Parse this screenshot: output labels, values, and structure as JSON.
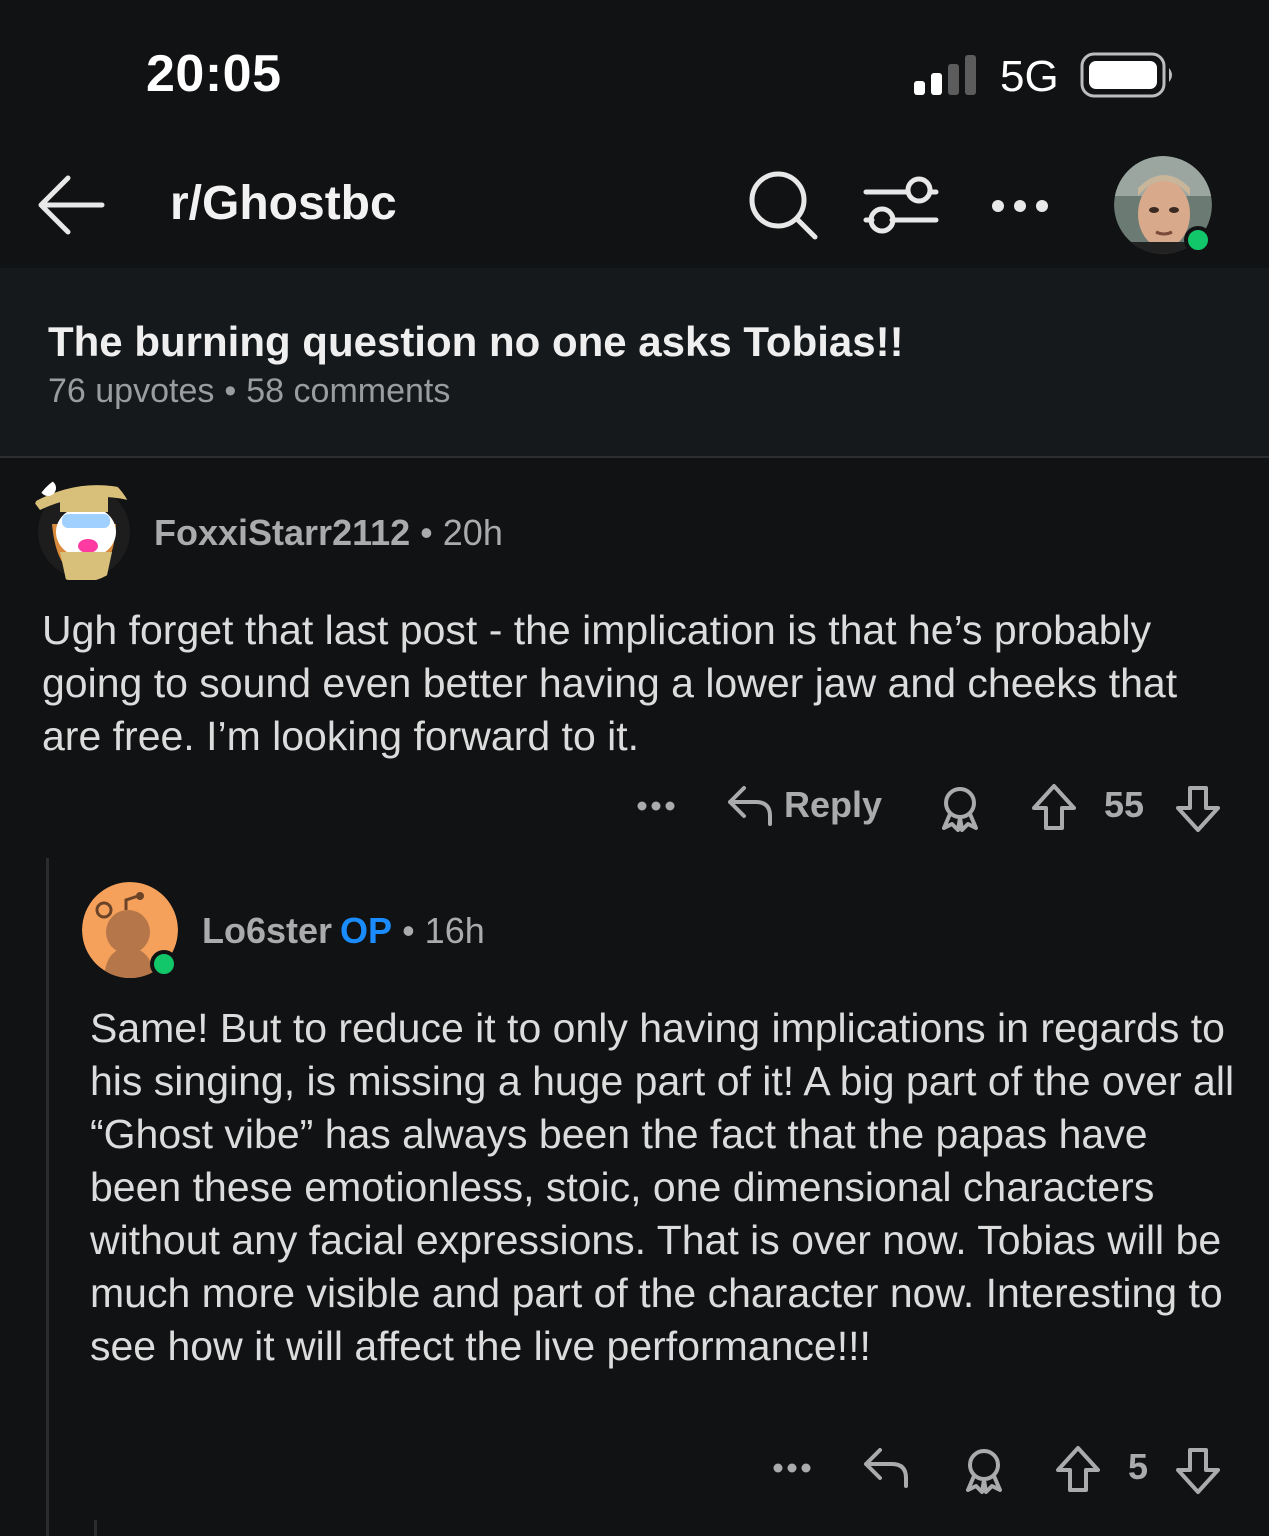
{
  "status_bar": {
    "time": "20:05",
    "network": "5G",
    "icons": [
      "signal-icon",
      "battery-icon"
    ]
  },
  "header": {
    "subreddit": "r/Ghostbc",
    "icons": [
      "back-arrow-icon",
      "search-icon",
      "filter-icon",
      "more-icon",
      "user-avatar"
    ]
  },
  "post": {
    "title": "The burning question no one asks Tobias!!",
    "upvotes": "76 upvotes",
    "separator": "•",
    "comments": "58 comments"
  },
  "comments": [
    {
      "username": "FoxxiStarr2112",
      "separator": "•",
      "age": "20h",
      "body": "Ugh forget that last post - the implication is that he’s probably going to sound even better having a lower jaw and cheeks that are free. I’m looking forward to it.",
      "reply_label": "Reply",
      "score": "55",
      "icons": [
        "more-icon",
        "reply-icon",
        "award-icon",
        "upvote-icon",
        "downvote-icon"
      ]
    },
    {
      "username": "Lo6ster",
      "op_badge": "OP",
      "separator": "•",
      "age": "16h",
      "body": "Same! But to reduce it to only having implications in regards to his singing, is missing a huge part of it! A big part of the over all “Ghost vibe” has always been the fact that the papas have been these emotionless, stoic, one dimensional characters without any facial expressions. That is over now. Tobias will be much more visible and part of the character now. Interesting to see how it will affect the live performance!!!",
      "score": "5",
      "icons": [
        "more-icon",
        "reply-icon",
        "award-icon",
        "upvote-icon",
        "downvote-icon"
      ]
    }
  ],
  "colors": {
    "background": "#111213",
    "post_strip": "#15191b",
    "op_blue": "#1a8cff",
    "online_green": "#12c76a",
    "muted_text": "#a9abad"
  }
}
